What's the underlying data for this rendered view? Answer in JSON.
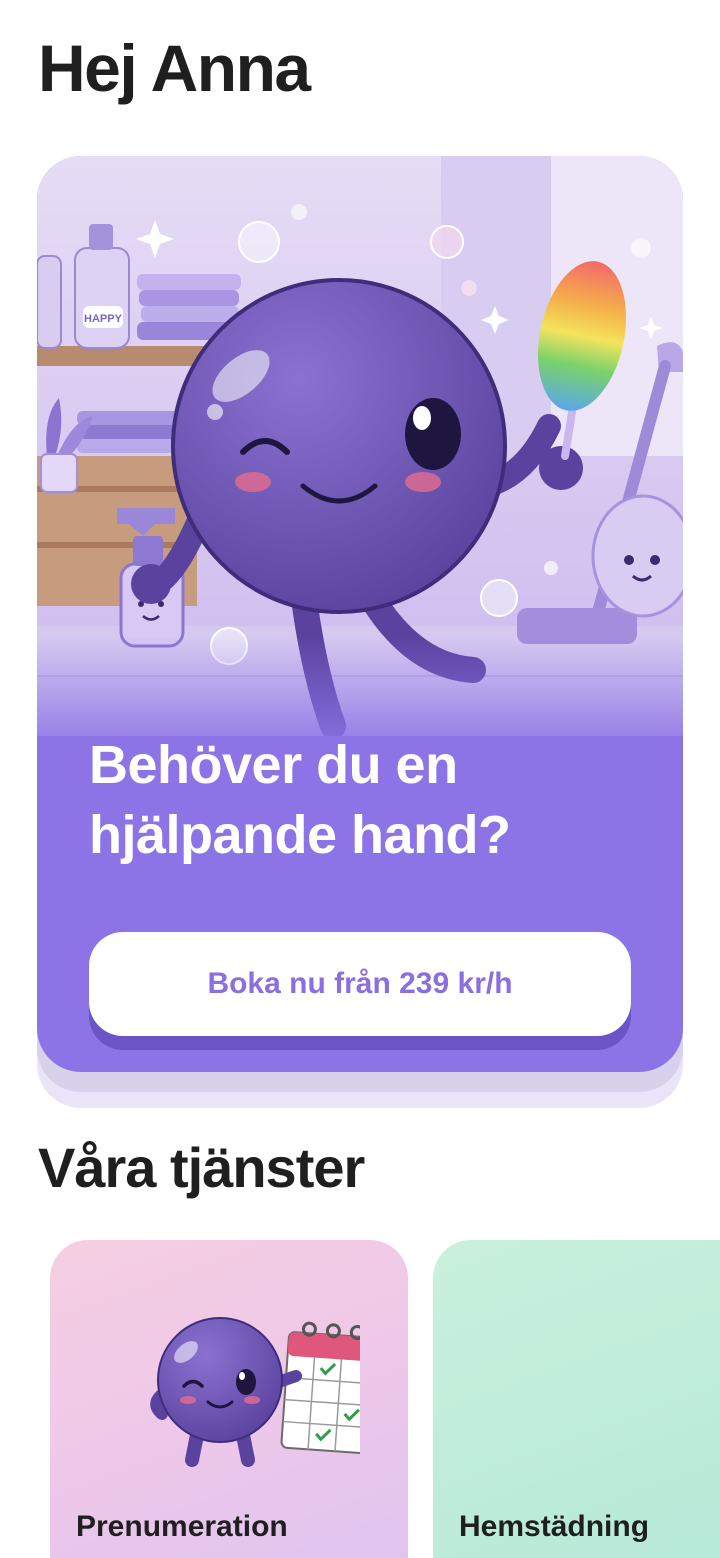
{
  "greeting": "Hej Anna",
  "hero": {
    "title_line1": "Behöver du en",
    "title_line2": "hjälpande hand?",
    "cta_label": "Boka nu från 239 kr/h",
    "illustration": "mascot-cleaning-illustration",
    "bottle_label": "HAPPY",
    "accent": "#8c74e6"
  },
  "services_section": {
    "title": "Våra tjänster",
    "cards": [
      {
        "label": "Prenumeration",
        "illustration": "mascot-calendar-illustration",
        "color": "#f3cde4"
      },
      {
        "label": "Hemstädning",
        "illustration": "",
        "color": "#c6efdc"
      }
    ]
  }
}
